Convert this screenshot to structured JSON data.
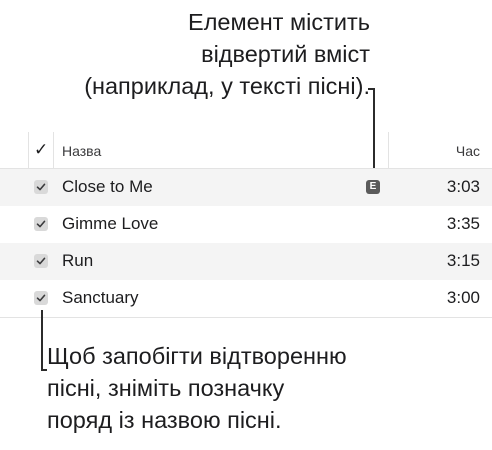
{
  "callouts": {
    "explicit": {
      "lines": [
        "Елемент містить",
        "відвертий вміст",
        "(наприклад, у тексті пісні)."
      ]
    },
    "uncheck": {
      "lines": [
        "Щоб запобігти відтворенню",
        "пісні, зніміть позначку",
        "поряд із назвою пісні."
      ]
    }
  },
  "table": {
    "columns": {
      "check": "✓",
      "name": "Назва",
      "time": "Час"
    },
    "rows": [
      {
        "title": "Close to Me",
        "time": "3:03",
        "checked": true,
        "explicit": true,
        "explicit_badge": "E"
      },
      {
        "title": "Gimme Love",
        "time": "3:35",
        "checked": true,
        "explicit": false
      },
      {
        "title": "Run",
        "time": "3:15",
        "checked": true,
        "explicit": false
      },
      {
        "title": "Sanctuary",
        "time": "3:00",
        "checked": true,
        "explicit": false
      }
    ]
  },
  "colors": {
    "row_alt_background": "#f4f4f4",
    "explicit_badge_background": "#5b5b5b",
    "checkbox_background": "#d9d9d9"
  }
}
